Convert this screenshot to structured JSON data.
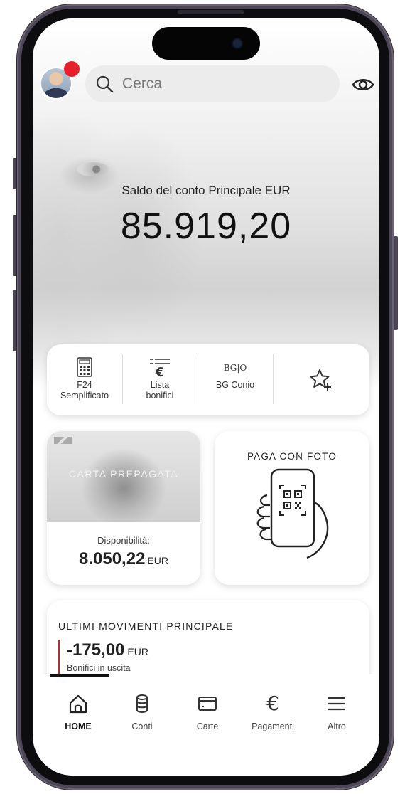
{
  "search": {
    "placeholder": "Cerca"
  },
  "balance": {
    "label": "Saldo del conto Principale EUR",
    "value": "85.919,20"
  },
  "quick_actions": [
    {
      "line1": "F24",
      "line2": "Semplificato",
      "icon": "f24-calculator-icon"
    },
    {
      "line1": "Lista",
      "line2": "bonifici",
      "icon": "euro-list-icon"
    },
    {
      "line1": "BG Conio",
      "line2": "",
      "icon": "bg-conio-icon"
    },
    {
      "line1": "",
      "line2": "",
      "icon": "star-add-icon"
    }
  ],
  "prepaid": {
    "title": "CARTA PREPAGATA",
    "availability_label": "Disponibilità:",
    "availability_value": "8.050,22",
    "currency": "EUR"
  },
  "photo_pay": {
    "title": "PAGA CON FOTO"
  },
  "movements": {
    "title": "ULTIMI MOVIMENTI PRINCIPALE",
    "items": [
      {
        "amount": "-175,00",
        "currency": "EUR",
        "description": "Bonifici in uscita"
      }
    ]
  },
  "tabs": [
    {
      "label": "HOME",
      "icon": "home-icon",
      "active": true
    },
    {
      "label": "Conti",
      "icon": "coins-icon",
      "active": false
    },
    {
      "label": "Carte",
      "icon": "card-icon",
      "active": false
    },
    {
      "label": "Pagamenti",
      "icon": "euro-icon",
      "active": false
    },
    {
      "label": "Altro",
      "icon": "menu-icon",
      "active": false
    }
  ],
  "colors": {
    "notification": "#e5202a",
    "outgoing_marker": "#b03030",
    "frame": "#4d4656"
  }
}
